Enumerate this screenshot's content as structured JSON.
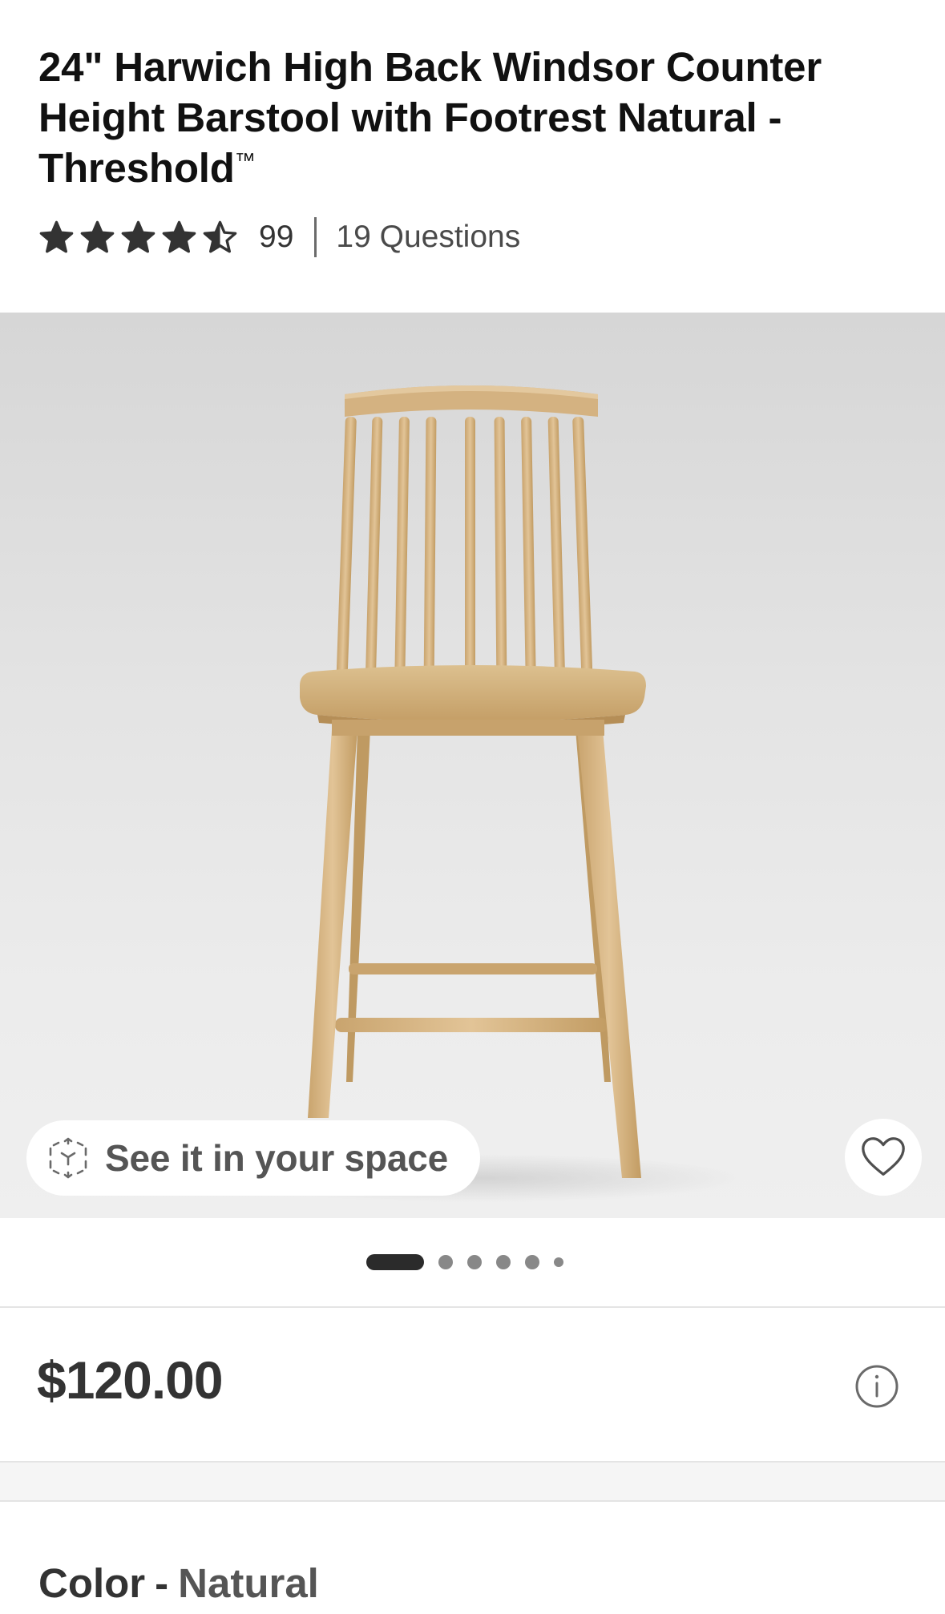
{
  "product": {
    "title": "24\" Harwich High Back Windsor Counter Height Barstool with Footrest Natural - Threshold",
    "title_trademark": "™",
    "rating": {
      "stars": 4.5,
      "max_stars": 5,
      "review_count": "99"
    },
    "questions_label": "19 Questions",
    "price": "$120.00"
  },
  "gallery": {
    "ar_button_label": "See it in your space",
    "ar_icon": "ar-cube-icon",
    "favorite_icon": "heart-outline-icon",
    "image_count": 6,
    "active_index": 0
  },
  "price_info_icon": "info-circle-icon",
  "variant": {
    "label": "Color",
    "separator": "-",
    "value": "Natural"
  },
  "colors": {
    "text": "#111111",
    "muted": "#555555",
    "wood": "#d8b887",
    "wood_dark": "#b9935c",
    "image_bg": "#e3e3e3"
  }
}
